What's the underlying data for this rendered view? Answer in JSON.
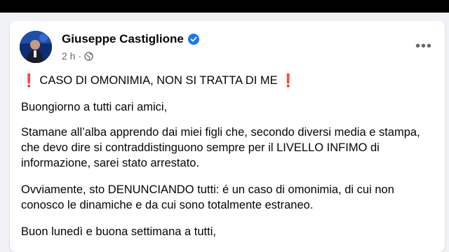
{
  "post": {
    "author_name": "Giuseppe Castiglione",
    "time": "2 h",
    "separator": "·",
    "more_label": "•••",
    "title_text": "CASO DI OMONIMIA, NON SI TRATTA DI ME",
    "title_emoji": "❗",
    "paragraphs": [
      "Buongiorno a tutti cari amici,",
      "Stamane all’alba apprendo dai miei figli che, secondo diversi media e stampa, che devo dire si contraddistinguono sempre per il LIVELLO INFIMO di informazione, sarei stato arrestato.",
      "Ovviamente, sto DENUNCIANDO tutti: é un caso di omonimia, di cui non conosco le dinamiche e da cui sono totalmente estraneo.",
      "Buon lunedì e buona settimana a tutti,"
    ],
    "icons": {
      "verified": "verified-badge-icon",
      "audience": "globe-icon",
      "menu": "more-options-icon"
    },
    "colors": {
      "verified_blue": "#1877f2",
      "exclamation_red": "#e0202b",
      "meta_gray": "#65676b"
    }
  }
}
